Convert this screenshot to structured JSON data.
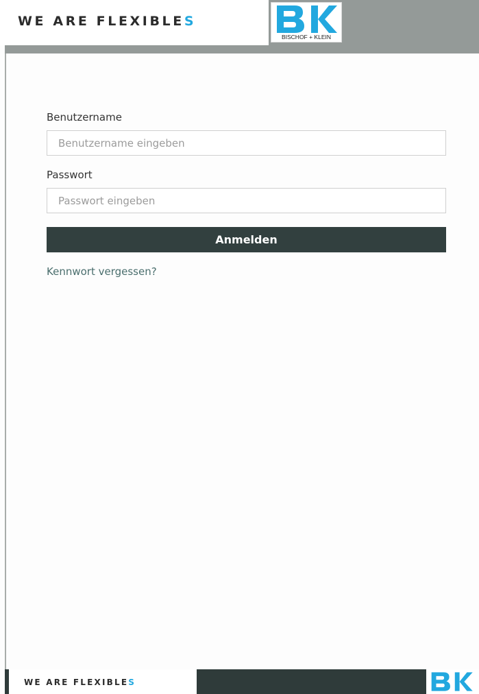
{
  "header": {
    "slogan_main": "WE ARE FLEXIBLE",
    "slogan_accent": "S",
    "logo_caption": "BISCHOF + KLEIN"
  },
  "login": {
    "username_label": "Benutzername",
    "username_placeholder": "Benutzername eingeben",
    "username_value": "",
    "password_label": "Passwort",
    "password_placeholder": "Passwort eingeben",
    "password_value": "",
    "submit_label": "Anmelden",
    "forgot_link": "Kennwort vergessen?"
  },
  "footer": {
    "slogan_main": "WE ARE FLEXIBLE",
    "slogan_accent": "S"
  },
  "colors": {
    "brand_blue": "#22a8df",
    "button_dark": "#32403f",
    "header_grey": "#949a98",
    "link": "#4a6e6d"
  },
  "icons": {
    "header_logo": "bk-logo-icon",
    "footer_logo": "bk-logo-icon"
  }
}
